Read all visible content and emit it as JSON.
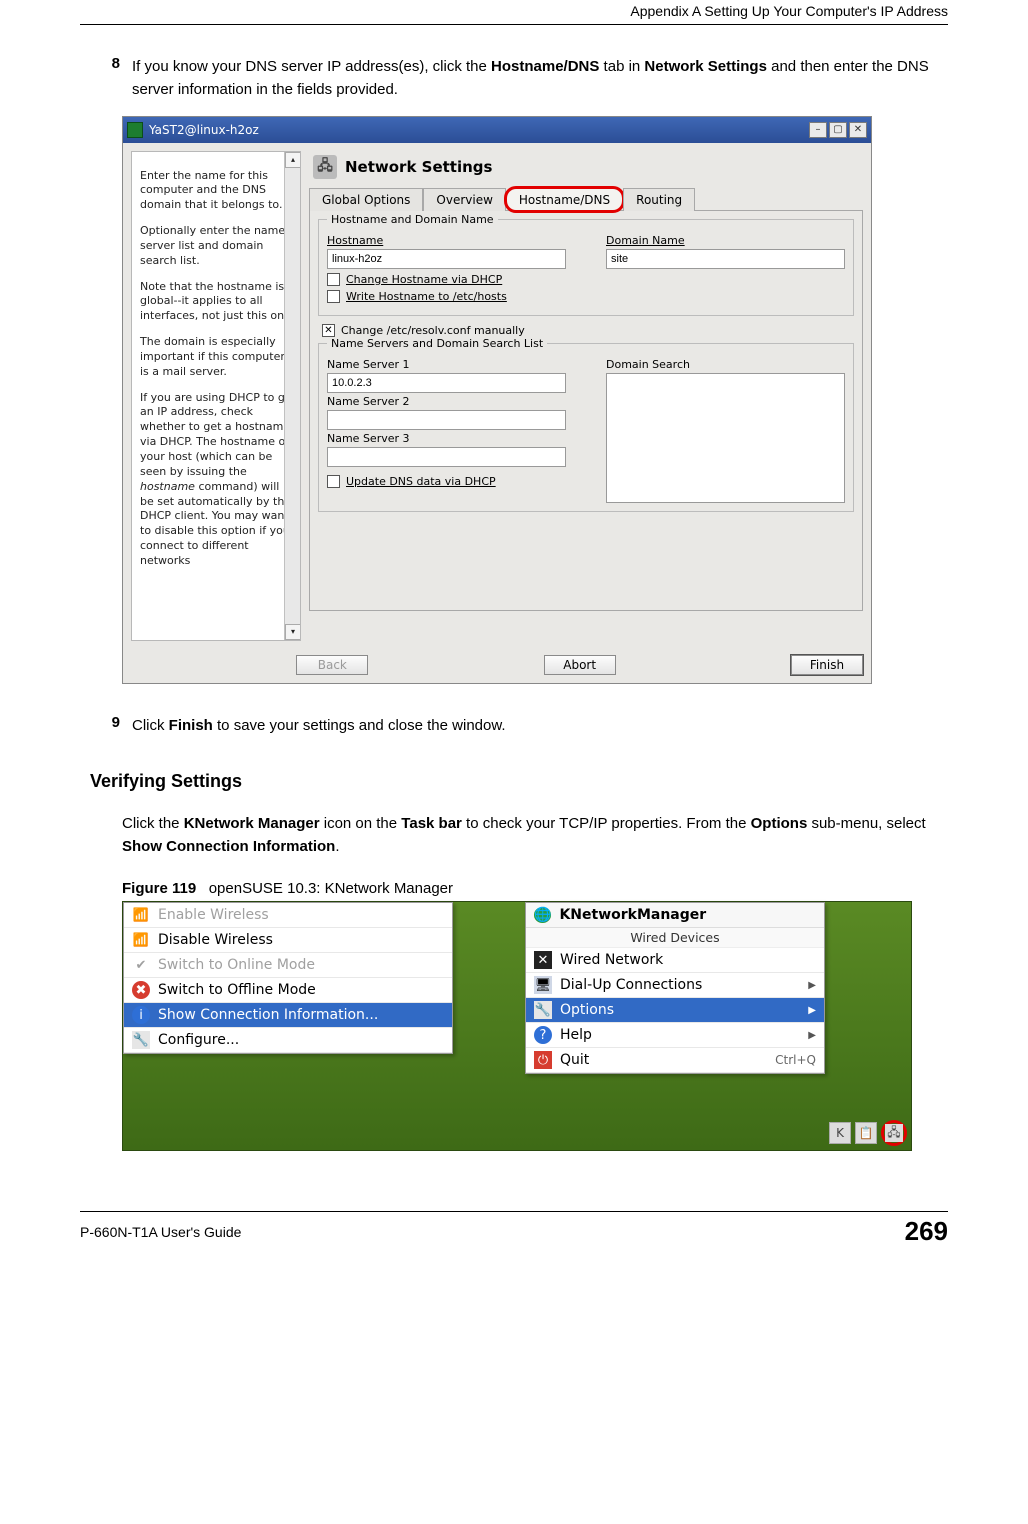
{
  "header": {
    "chapter": "Appendix A Setting Up Your Computer's IP Address"
  },
  "steps": {
    "s8": {
      "num": "8",
      "t1": "If you know your DNS server IP address(es), click the ",
      "b1": "Hostname/DNS",
      "t2": " tab in ",
      "b2": "Network Settings",
      "t3": " and then enter the DNS server information in the fields provided."
    },
    "s9": {
      "num": "9",
      "t1": "Click ",
      "b1": "Finish",
      "t2": " to save your settings and close the window."
    }
  },
  "section": {
    "verify": "Verifying Settings"
  },
  "verify_para": {
    "t1": "Click the ",
    "b1": "KNetwork Manager",
    "t2": " icon on the ",
    "b2": "Task bar",
    "t3": " to check your TCP/IP properties. From the ",
    "b3": "Options",
    "t4": " sub-menu, select ",
    "b4": "Show Connection Information",
    "t5": "."
  },
  "figure": {
    "label": "Figure 119",
    "caption": "openSUSE 10.3: KNetwork Manager"
  },
  "yast": {
    "title": "YaST2@linux-h2oz",
    "heading": "Network Settings",
    "tabs": {
      "global": "Global Options",
      "overview": "Overview",
      "hostdns": "Hostname/DNS",
      "routing": "Routing"
    },
    "group1": "Hostname and Domain Name",
    "hostname_label": "Hostname",
    "hostname_value": "linux-h2oz",
    "domain_label": "Domain Name",
    "domain_value": "site",
    "chk_dhcp_host": "Change Hostname via DHCP",
    "chk_write_hosts": "Write Hostname to /etc/hosts",
    "chk_resolv": "Change /etc/resolv.conf manually",
    "group2": "Name Servers and Domain Search List",
    "ns1_label": "Name Server 1",
    "ns1_value": "10.0.2.3",
    "ns2_label": "Name Server 2",
    "ns3_label": "Name Server 3",
    "domsearch_label": "Domain Search",
    "chk_update_dns": "Update DNS data via DHCP",
    "btn_back": "Back",
    "btn_abort": "Abort",
    "btn_finish": "Finish",
    "help": {
      "p1": "Enter the name for this computer and the DNS domain that it belongs to.",
      "p2": "Optionally enter the name server list and domain search list.",
      "p3": "Note that the hostname is global--it applies to all interfaces, not just this one.",
      "p4": "The domain is especially important if this computer is a mail server.",
      "p5a": "If you are using DHCP to get an IP address, check whether to get a hostname via DHCP. The hostname of your host (which can be seen by issuing the ",
      "p5i": "hostname",
      "p5b": " command) will be set automatically by the DHCP client. You may want to disable this option if you connect to different networks"
    }
  },
  "kmenu": {
    "left": {
      "enable_wireless": "Enable Wireless",
      "disable_wireless": "Disable Wireless",
      "switch_online": "Switch to Online Mode",
      "switch_offline": "Switch to Offline Mode",
      "show_conn": "Show Connection Information...",
      "configure": "Configure..."
    },
    "right": {
      "title": "KNetworkManager",
      "subhead": "Wired Devices",
      "wired": "Wired Network",
      "dialup": "Dial-Up Connections",
      "options": "Options",
      "help": "Help",
      "quit": "Quit",
      "quit_sc": "Ctrl+Q"
    }
  },
  "footer": {
    "guide": "P-660N-T1A User's Guide",
    "page": "269"
  }
}
